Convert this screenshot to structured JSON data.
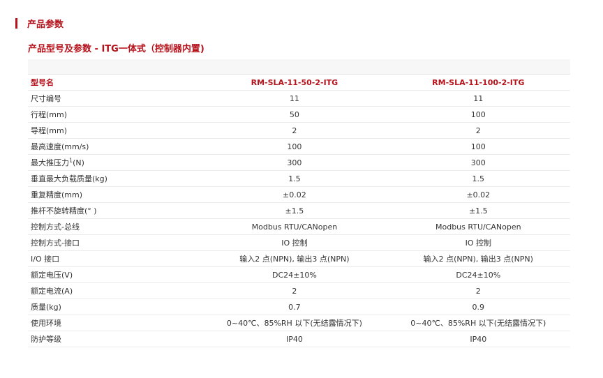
{
  "section": {
    "title": "产品参数"
  },
  "subtitle": "产品型号及参数 - ITG一体式（控制器内置)",
  "table": {
    "header": {
      "label": "型号名",
      "models": [
        "RM-SLA-11-50-2-ITG",
        "RM-SLA-11-100-2-ITG"
      ]
    },
    "rows": [
      {
        "label": "尺寸编号",
        "values": [
          "11",
          "11"
        ]
      },
      {
        "label": "行程(mm)",
        "values": [
          "50",
          "100"
        ]
      },
      {
        "label": "导程(mm)",
        "values": [
          "2",
          "2"
        ]
      },
      {
        "label": "最高速度(mm/s)",
        "values": [
          "100",
          "100"
        ]
      },
      {
        "label": "最大推压力",
        "sup": "1",
        "suffix": "(N)",
        "values": [
          "300",
          "300"
        ]
      },
      {
        "label": "垂直最大负载质量(kg)",
        "values": [
          "1.5",
          "1.5"
        ]
      },
      {
        "label": "重复精度(mm)",
        "values": [
          "±0.02",
          "±0.02"
        ]
      },
      {
        "label": "推杆不旋转精度(° )",
        "values": [
          "±1.5",
          "±1.5"
        ]
      },
      {
        "label": "控制方式-总线",
        "values": [
          "Modbus RTU/CANopen",
          "Modbus RTU/CANopen"
        ]
      },
      {
        "label": "控制方式-接口",
        "values": [
          "IO 控制",
          "IO 控制"
        ]
      },
      {
        "label": "I/O 接口",
        "values": [
          "输入2 点(NPN), 输出3 点(NPN)",
          "输入2 点(NPN), 输出3 点(NPN)"
        ]
      },
      {
        "label": "额定电压(V)",
        "values": [
          "DC24±10%",
          "DC24±10%"
        ]
      },
      {
        "label": "额定电流(A)",
        "values": [
          "2",
          "2"
        ]
      },
      {
        "label": "质量(kg)",
        "values": [
          "0.7",
          "0.9"
        ]
      },
      {
        "label": "使用环境",
        "values": [
          "0~40℃、85%RH 以下(无结露情况下)",
          "0~40℃、85%RH 以下(无结露情况下)"
        ]
      },
      {
        "label": "防护等级",
        "values": [
          "IP40",
          "IP40"
        ]
      }
    ]
  },
  "colors": {
    "accent": "#b5121b",
    "text": "#333333",
    "blank_row": "#f7f7f7"
  }
}
